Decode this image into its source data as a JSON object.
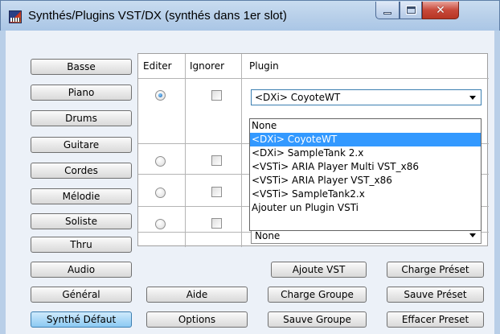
{
  "window": {
    "title": "Synthés/Plugins VST/DX (synthés dans 1er slot)"
  },
  "sidebar": {
    "buttons": [
      "Basse",
      "Piano",
      "Drums",
      "Guitare",
      "Cordes",
      "Mélodie",
      "Soliste",
      "Thru",
      "Audio",
      "Général",
      "Synthé Défaut"
    ],
    "active": "Synthé Défaut"
  },
  "table": {
    "headers": {
      "edit": "Editer",
      "ignore": "Ignorer",
      "plugin": "Plugin"
    },
    "rows": [
      {
        "edit_checked": true,
        "ignore_checked": false,
        "plugin": "<DXi> CoyoteWT"
      },
      {
        "edit_checked": false,
        "ignore_checked": false,
        "plugin": ""
      },
      {
        "edit_checked": false,
        "ignore_checked": false,
        "plugin": ""
      },
      {
        "edit_checked": false,
        "ignore_checked": false,
        "plugin": "None"
      }
    ]
  },
  "dropdown": {
    "options": [
      "None",
      "<DXi> CoyoteWT",
      "<DXi> SampleTank 2.x",
      "<VSTi> ARIA Player Multi VST_x86",
      "<VSTi> ARIA Player VST_x86",
      "<VSTi> SampleTank2.x",
      "Ajouter un Plugin  VSTi"
    ],
    "selected_index": 1
  },
  "actions": {
    "add_vst": "Ajoute VST",
    "load_preset": "Charge Préset",
    "help": "Aide",
    "load_group": "Charge Groupe",
    "save_preset": "Sauve Préset",
    "options": "Options",
    "save_group": "Sauve Groupe",
    "delete_preset": "Effacer Preset"
  },
  "colors": {
    "accent": "#3399ff",
    "active_button": "#a9d8f7",
    "close_button": "#c8493a"
  }
}
